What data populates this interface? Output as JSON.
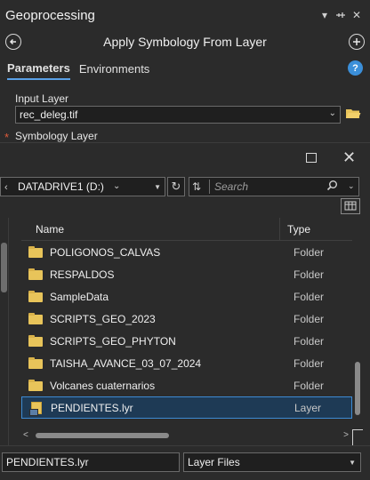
{
  "geoprocessing": {
    "pane_title": "Geoprocessing",
    "pin_glyph": "⊕",
    "close_glyph": "✕",
    "menu_glyph": "▾",
    "tool_title": "Apply Symbology From Layer",
    "tabs": [
      {
        "label": "Parameters",
        "active": true
      },
      {
        "label": "Environments",
        "active": false
      }
    ],
    "help_label": "?",
    "input_layer_label": "Input Layer",
    "input_layer_value": "rec_deleg.tif",
    "symbology_layer_label": "Symbology Layer",
    "required_marker": "*"
  },
  "dialog": {
    "drive_label": "DATADRIVE1 (D:)",
    "search_placeholder": "Search",
    "columns": {
      "name": "Name",
      "type": "Type"
    },
    "items": [
      {
        "name": "POLIGONOS_CALVAS",
        "type": "Folder",
        "icon": "folder-icon",
        "selected": false
      },
      {
        "name": "RESPALDOS",
        "type": "Folder",
        "icon": "folder-icon",
        "selected": false
      },
      {
        "name": "SampleData",
        "type": "Folder",
        "icon": "folder-icon",
        "selected": false
      },
      {
        "name": "SCRIPTS_GEO_2023",
        "type": "Folder",
        "icon": "folder-icon",
        "selected": false
      },
      {
        "name": "SCRIPTS_GEO_PHYTON",
        "type": "Folder",
        "icon": "folder-icon",
        "selected": false
      },
      {
        "name": "TAISHA_AVANCE_03_07_2024",
        "type": "Folder",
        "icon": "folder-icon",
        "selected": false
      },
      {
        "name": "Volcanes cuaternarios",
        "type": "Folder",
        "icon": "folder-icon",
        "selected": false
      },
      {
        "name": "PENDIENTES.lyr",
        "type": "Layer",
        "icon": "layer-file-icon",
        "selected": true
      }
    ],
    "filename_value": "PENDIENTES.lyr",
    "filter_value": "Layer Files"
  },
  "colors": {
    "background": "#2b2b2b",
    "accent": "#3d8bd4",
    "folder": "#e8c45a",
    "required": "#e05b3a"
  }
}
